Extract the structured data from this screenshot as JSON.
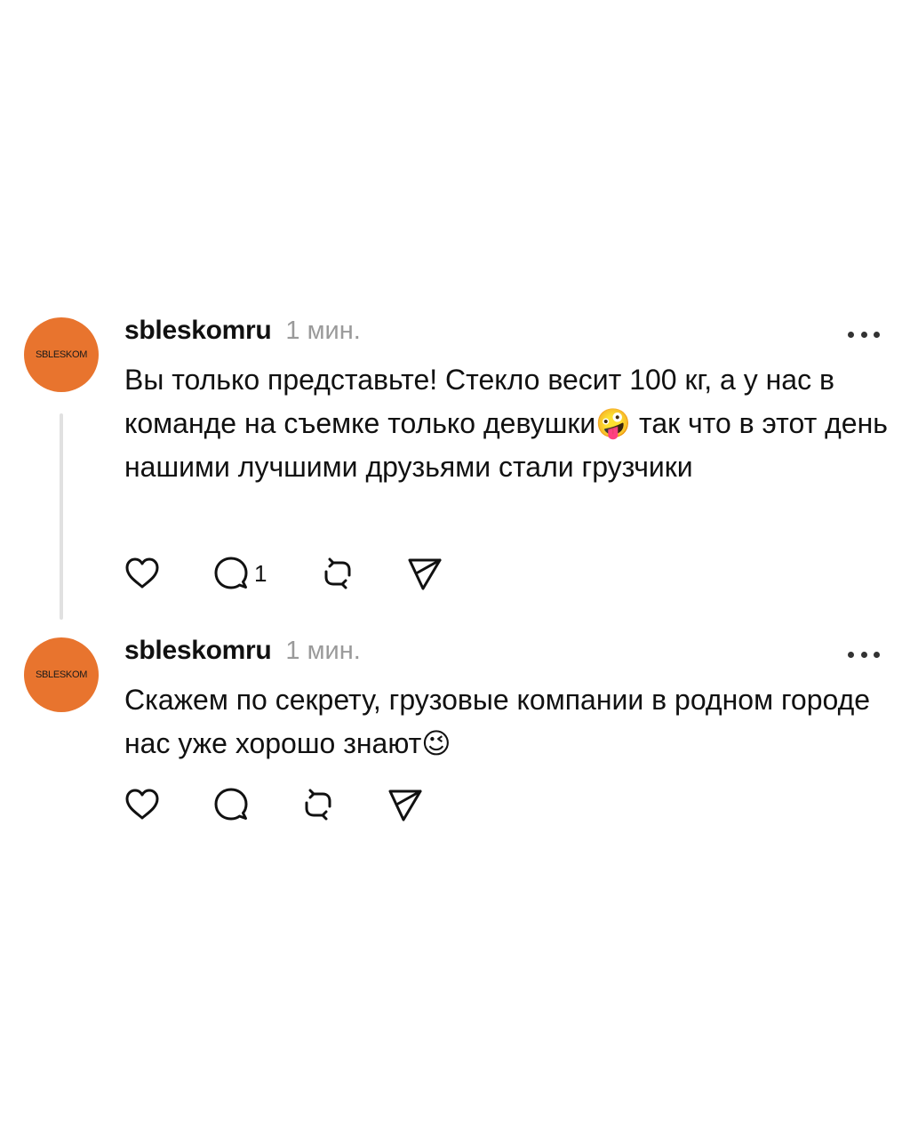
{
  "posts": [
    {
      "avatar_text": "SBLESKOM",
      "username": "sbleskomru",
      "time": "1 мин.",
      "text": "Вы только представьте! Стекло весит 100 кг, а у нас в команде на съемке только девушки🤪 так что в этот день нашими лучшими друзьями стали грузчики",
      "reply_count": "1",
      "icons": [
        "heart-icon",
        "comment-icon",
        "repost-icon",
        "share-icon",
        "more-icon"
      ]
    },
    {
      "avatar_text": "SBLESKOM",
      "username": "sbleskomru",
      "time": "1 мин.",
      "text": "Скажем по секрету, грузовые компании в родном городе нас уже хорошо знают😉",
      "reply_count": "",
      "icons": [
        "heart-icon",
        "comment-icon",
        "repost-icon",
        "share-icon",
        "more-icon"
      ]
    }
  ],
  "colors": {
    "avatar_bg": "#e8742e",
    "muted_text": "#9a9a9a",
    "thread_line": "#e1e1e1"
  }
}
